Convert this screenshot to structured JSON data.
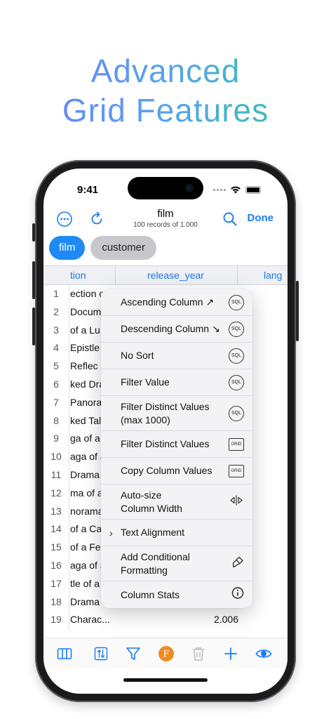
{
  "headline": {
    "line1": "Advanced",
    "line2": "Grid Features"
  },
  "status_bar": {
    "time": "9:41"
  },
  "nav": {
    "title": "film",
    "subtitle": "100 records of 1.000",
    "done_label": "Done"
  },
  "tabs": [
    {
      "label": "film"
    },
    {
      "label": "customer"
    }
  ],
  "grid": {
    "columns": [
      "tion",
      "release_year",
      "lang"
    ],
    "rows": [
      {
        "num": "1",
        "text": "ection o"
      },
      {
        "num": "2",
        "text": "Docum"
      },
      {
        "num": "3",
        "text": "of a Lu"
      },
      {
        "num": "4",
        "text": "Epistle"
      },
      {
        "num": "5",
        "text": "Reflec"
      },
      {
        "num": "6",
        "text": "ked Dra"
      },
      {
        "num": "7",
        "text": "Panora"
      },
      {
        "num": "8",
        "text": "ked Tale"
      },
      {
        "num": "9",
        "text": "ga of a..."
      },
      {
        "num": "10",
        "text": "aga of a"
      },
      {
        "num": "11",
        "text": "Drama o"
      },
      {
        "num": "12",
        "text": "ma of a"
      },
      {
        "num": "13",
        "text": "noramal"
      },
      {
        "num": "14",
        "text": "of a Ca"
      },
      {
        "num": "15",
        "text": "of a Fe"
      },
      {
        "num": "16",
        "text": "aga of a"
      },
      {
        "num": "17",
        "text": "tle of a"
      },
      {
        "num": "18",
        "text": "Drama"
      },
      {
        "num": "19",
        "text": "Charac..."
      }
    ],
    "last_value": "2.006"
  },
  "context_menu": {
    "items": [
      {
        "label": "Ascending Column ↗",
        "badge": "SQL",
        "icon": "sql-icon"
      },
      {
        "label": "Descending Column ↘",
        "badge": "SQL",
        "icon": "sql-icon"
      },
      {
        "label": "No Sort",
        "badge": "SQL",
        "icon": "sql-icon"
      },
      {
        "label": "Filter Value",
        "badge": "SQL",
        "icon": "sql-icon"
      },
      {
        "label": "Filter Distinct Values\n(max 1000)",
        "badge": "SQL",
        "icon": "sql-icon"
      },
      {
        "label": "Filter Distinct Values",
        "badge": "GRID",
        "icon": "grid-icon"
      },
      {
        "label": "Copy Column Values",
        "badge": "GRID",
        "icon": "grid-icon"
      },
      {
        "label": "Auto-size\nColumn Width",
        "badge": "",
        "icon": "resize-column-icon"
      },
      {
        "label": "Text Alignment",
        "badge": "",
        "icon": "chevron-right-icon"
      },
      {
        "label": "Add Conditional\nFormatting",
        "badge": "",
        "icon": "paintbrush-icon"
      },
      {
        "label": "Column Stats",
        "badge": "",
        "icon": "info-icon"
      }
    ]
  },
  "toolbar": {
    "icons": [
      "columns-icon",
      "sort-rows-icon",
      "filter-icon",
      "function-icon",
      "trash-icon",
      "add-icon",
      "eye-icon"
    ],
    "function_label": "F"
  },
  "colors": {
    "accent": "#1a7bf5",
    "function_badge": "#f08a24"
  }
}
